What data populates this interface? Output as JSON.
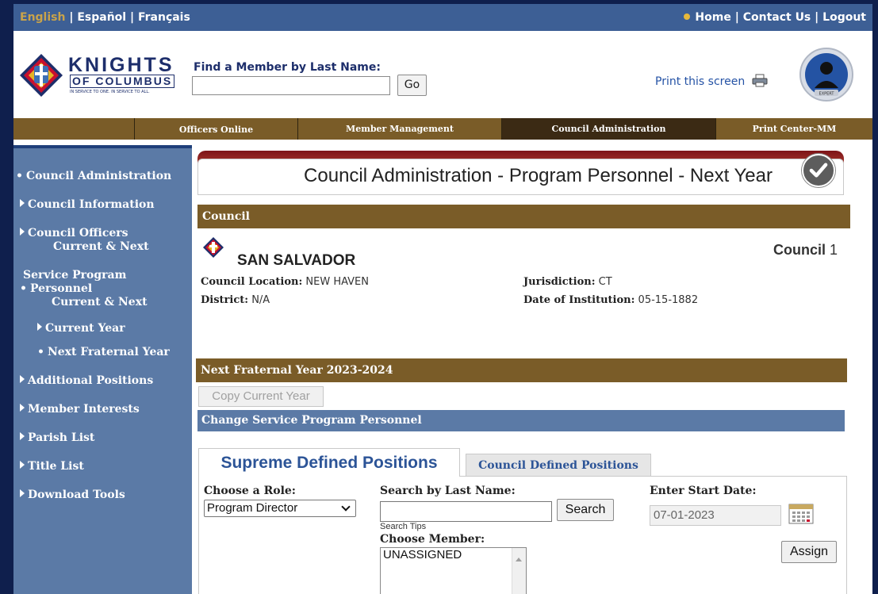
{
  "topbar": {
    "languages": [
      "English",
      "Español",
      "Français"
    ],
    "separator": " | ",
    "links": [
      "Home",
      "Contact Us",
      "Logout"
    ]
  },
  "header": {
    "logo_line1": "KNIGHTS",
    "logo_line2": "OF COLUMBUS",
    "logo_tagline": "IN SERVICE TO ONE. IN SERVICE TO ALL.",
    "find_label": "Find a Member by Last Name:",
    "find_value": "",
    "go_label": "Go",
    "print_label": "Print this screen",
    "expert_badge": "EXPERT"
  },
  "nav": {
    "items": [
      "Officers Online",
      "Member Management",
      "Council Administration",
      "Print Center-MM"
    ],
    "active": "Council Administration"
  },
  "sidebar": {
    "items": [
      {
        "label": "Council Administration",
        "marker": "•"
      },
      {
        "label": "Council Information",
        "marker": "▸"
      },
      {
        "label": "Council Officers",
        "sub": "Current & Next",
        "marker": "▸"
      },
      {
        "label": "Service Program",
        "label2": "Personnel",
        "sub": "Current & Next",
        "marker": "•"
      },
      {
        "label": "Current Year",
        "marker": "▸"
      },
      {
        "label": "Next Fraternal Year",
        "marker": "•"
      },
      {
        "label": "Additional Positions",
        "marker": "▸"
      },
      {
        "label": "Member Interests",
        "marker": "▸"
      },
      {
        "label": "Parish List",
        "marker": "▸"
      },
      {
        "label": "Title List",
        "marker": "▸"
      },
      {
        "label": "Download Tools",
        "marker": "▸"
      }
    ]
  },
  "main": {
    "page_title": "Council Administration - Program Personnel - Next Year",
    "council_section": "Council",
    "council_name": "SAN SALVADOR",
    "council_number_label": "Council",
    "council_number": "1",
    "location_label": "Council Location:",
    "location": "NEW HAVEN",
    "district_label": "District:",
    "district": "N/A",
    "jurisdiction_label": "Jurisdiction:",
    "jurisdiction": "CT",
    "institution_label": "Date of Institution:",
    "institution_date": "05-15-1882",
    "year_section": "Next Fraternal Year 2023-2024",
    "copy_button": "Copy Current Year",
    "change_section": "Change Service Program Personnel",
    "tabs": [
      "Supreme Defined Positions",
      "Council Defined Positions"
    ],
    "active_tab": "Supreme Defined Positions",
    "role_label": "Choose a Role:",
    "role_value": "Program Director",
    "search_label": "Search by Last Name:",
    "search_value": "",
    "search_button": "Search",
    "search_tips": "Search Tips",
    "member_label": "Choose Member:",
    "member_options": [
      "UNASSIGNED"
    ],
    "start_date_label": "Enter Start Date:",
    "start_date": "07-01-2023",
    "assign_button": "Assign"
  },
  "colors": {
    "topbar": "#3d5f95",
    "nav_brown": "#7a5c28",
    "nav_active": "#3b2a14",
    "sidebar": "#5b7aa6",
    "title_band": "#7d1418",
    "tab_text": "#2c5497",
    "outer_background": "#0f1f4d"
  },
  "icons": [
    "knights-emblem-icon",
    "printer-icon",
    "expert-avatar-icon",
    "checkmark-icon",
    "calendar-icon",
    "chevron-down-icon",
    "scroll-up-icon"
  ]
}
